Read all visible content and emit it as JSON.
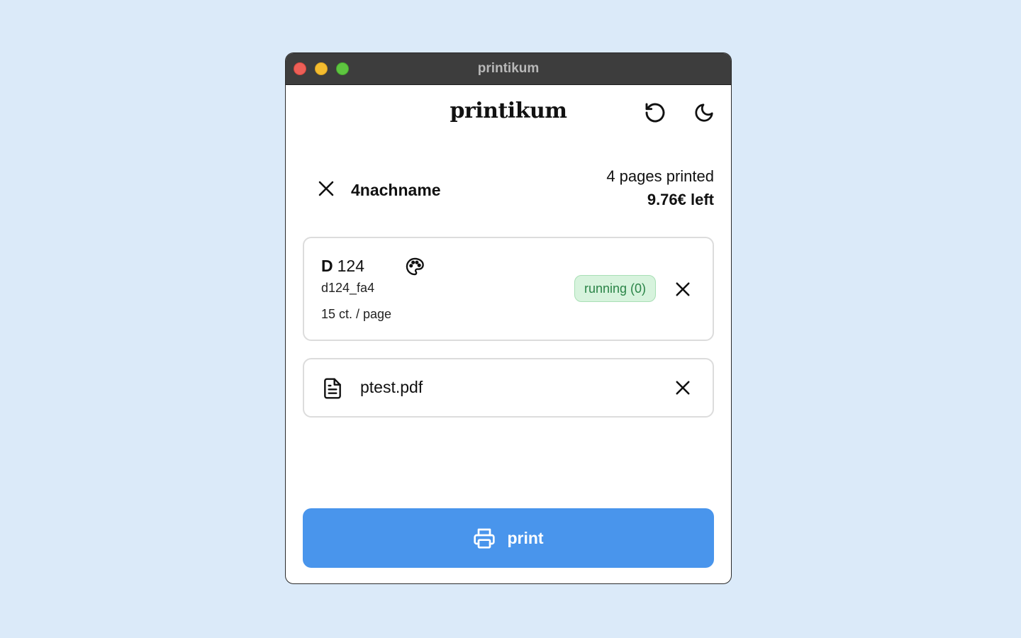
{
  "window": {
    "title": "printikum"
  },
  "header": {
    "brand": "printikum",
    "reload_icon": "reload-icon",
    "theme_icon": "moon-icon"
  },
  "user": {
    "name": "4nachname",
    "pages_printed": "4 pages printed",
    "balance": "9.76€ left"
  },
  "printer": {
    "building": "D",
    "room": "124",
    "id": "d124_fa4",
    "price": "15 ct. / page",
    "status": "running (0)",
    "color_icon": "palette-icon"
  },
  "file": {
    "name": "ptest.pdf",
    "icon": "document-icon"
  },
  "actions": {
    "print_label": "print"
  },
  "colors": {
    "background": "#dbeaf9",
    "accent": "#4995ec",
    "status_bg": "#d7f3dd",
    "status_text": "#2a8447"
  }
}
